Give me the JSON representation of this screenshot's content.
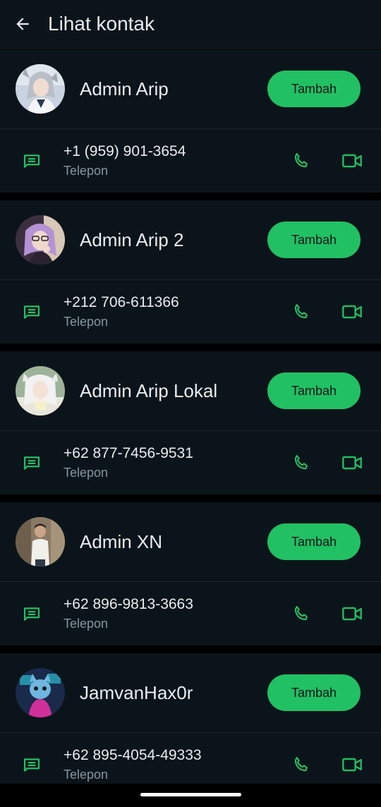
{
  "header": {
    "title": "Lihat kontak",
    "back_icon": "arrow-left-icon"
  },
  "colors": {
    "accent": "#21c063",
    "background": "#0b141a",
    "separator": "#000000",
    "text_primary": "#e9edef",
    "text_secondary": "#8696a0"
  },
  "contacts": [
    {
      "name": "Admin Arip",
      "add_label": "Tambah",
      "phone": "+1 (959) 901-3654",
      "phone_type": "Telepon",
      "avatar_style": "silver-hair-cosplay"
    },
    {
      "name": "Admin Arip 2",
      "add_label": "Tambah",
      "phone": "+212 706-611366",
      "phone_type": "Telepon",
      "avatar_style": "purple-hair-cosplay"
    },
    {
      "name": "Admin Arip Lokal",
      "add_label": "Tambah",
      "phone": "+62 877-7456-9531",
      "phone_type": "Telepon",
      "avatar_style": "white-hair-cosplay"
    },
    {
      "name": "Admin XN",
      "add_label": "Tambah",
      "phone": "+62 896-9813-3663",
      "phone_type": "Telepon",
      "avatar_style": "man-street-photo"
    },
    {
      "name": "JamvanHax0r",
      "add_label": "Tambah",
      "phone": "+62 895-4054-49333",
      "phone_type": "Telepon",
      "avatar_style": "cartoon-hacker-cat"
    }
  ],
  "icons": {
    "message": "message-icon",
    "call": "phone-call-icon",
    "video": "video-call-icon"
  }
}
